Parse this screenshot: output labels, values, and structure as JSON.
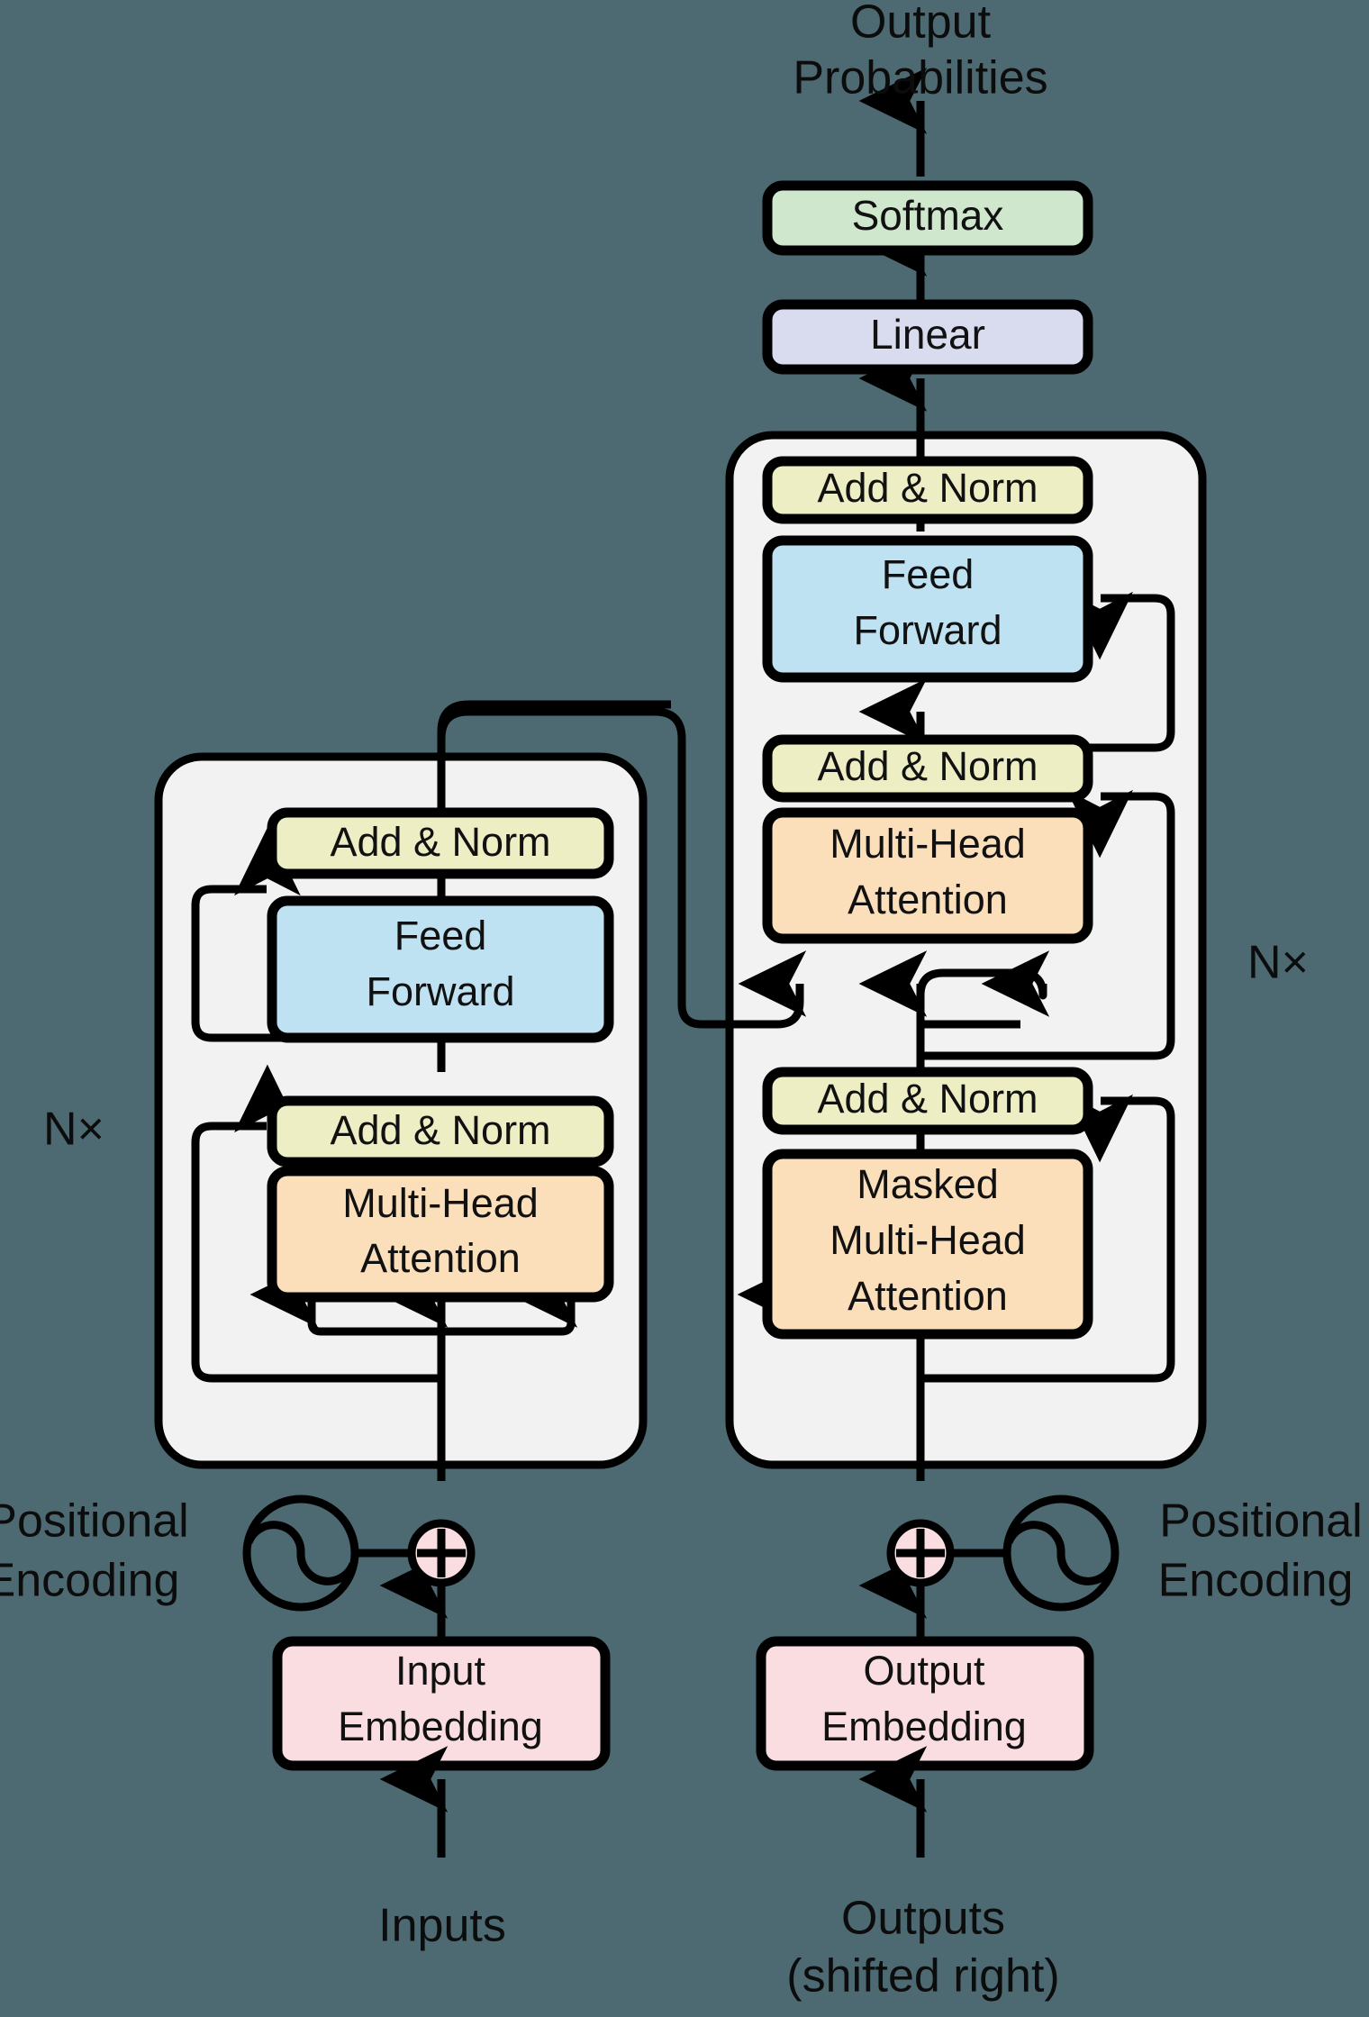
{
  "figure": {
    "name": "transformer-architecture",
    "background_color": "#4d6a72"
  },
  "labels": {
    "output_probabilities_line1": "Output",
    "output_probabilities_line2": "Probabilities",
    "inputs": "Inputs",
    "outputs_line1": "Outputs",
    "outputs_line2": "(shifted right)",
    "encoder_repeat": "N×",
    "decoder_repeat": "N×",
    "positional_encoding_left_line1": "Positional",
    "positional_encoding_left_line2": "Encoding",
    "positional_encoding_right_line1": "Positional",
    "positional_encoding_right_line2": "Encoding"
  },
  "blocks": {
    "softmax": {
      "label": "Softmax",
      "color": "#cfe7cc"
    },
    "linear": {
      "label": "Linear",
      "color": "#d9dcee"
    },
    "encoder_add_norm_top": {
      "label": "Add & Norm",
      "color": "#eeeec4"
    },
    "encoder_feed_forward": {
      "label_line1": "Feed",
      "label_line2": "Forward",
      "color": "#bfe2f3"
    },
    "encoder_add_norm_bottom": {
      "label": "Add & Norm",
      "color": "#eeeec4"
    },
    "encoder_multi_head_attention": {
      "label_line1": "Multi-Head",
      "label_line2": "Attention",
      "color": "#fbdfbb"
    },
    "decoder_add_norm_top": {
      "label": "Add & Norm",
      "color": "#eeeec4"
    },
    "decoder_feed_forward": {
      "label_line1": "Feed",
      "label_line2": "Forward",
      "color": "#bfe2f3"
    },
    "decoder_add_norm_mid": {
      "label": "Add & Norm",
      "color": "#eeeec4"
    },
    "decoder_multi_head_attention": {
      "label_line1": "Multi-Head",
      "label_line2": "Attention",
      "color": "#fbdfbb"
    },
    "decoder_add_norm_bottom": {
      "label": "Add & Norm",
      "color": "#eeeec4"
    },
    "decoder_masked_multi_head_attention": {
      "label_line1": "Masked",
      "label_line2": "Multi-Head",
      "label_line3": "Attention",
      "color": "#fbdfbb"
    },
    "input_embedding": {
      "label_line1": "Input",
      "label_line2": "Embedding",
      "color": "#fadde1"
    },
    "output_embedding": {
      "label_line1": "Output",
      "label_line2": "Embedding",
      "color": "#fadde1"
    },
    "encoder_stack_panel": {
      "color": "#f2f2f2"
    },
    "decoder_stack_panel": {
      "color": "#f2f2f2"
    },
    "add_operator_left": {
      "symbol": "⊕",
      "color": "#fadde1"
    },
    "add_operator_right": {
      "symbol": "⊕",
      "color": "#fadde1"
    }
  }
}
